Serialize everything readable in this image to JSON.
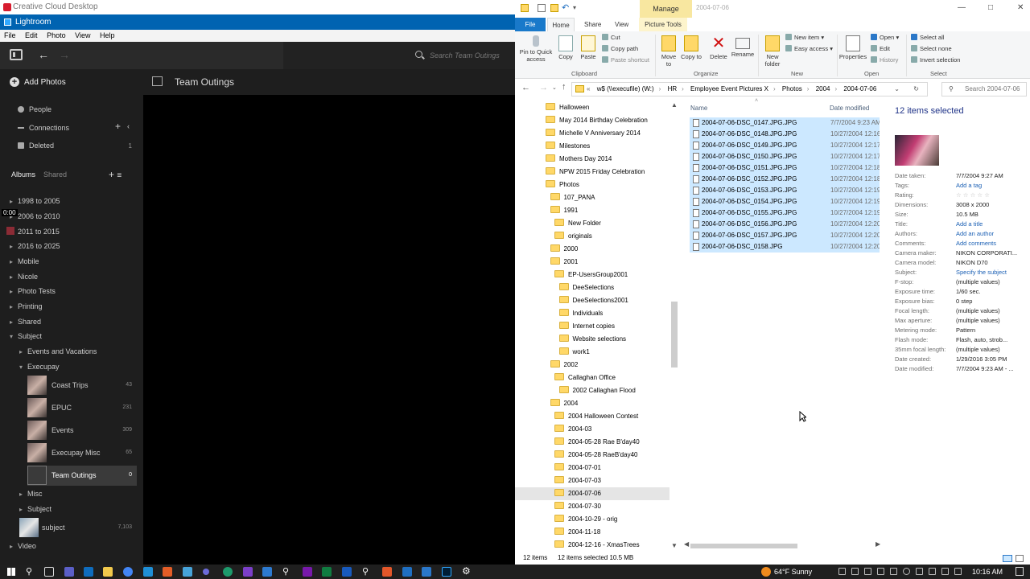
{
  "cc_title": "Creative Cloud Desktop",
  "lr": {
    "title": "Lightroom",
    "menu": [
      "File",
      "Edit",
      "Photo",
      "View",
      "Help"
    ],
    "search_placeholder": "Search Team Outings",
    "add_photos": "Add Photos",
    "nav": [
      {
        "label": "People",
        "count": ""
      },
      {
        "label": "Connections",
        "count": ""
      },
      {
        "label": "Deleted",
        "count": "1"
      }
    ],
    "albums_tab": "Albums",
    "shared_tab": "Shared",
    "tree": [
      "1998 to 2005",
      "2006 to 2010",
      "2011 to 2015",
      "2016 to 2025",
      "Mobile",
      "Nicole",
      "Photo Tests",
      "Printing",
      "Shared",
      "Subject"
    ],
    "subject_children": [
      "Events and Vacations",
      "Execupay"
    ],
    "albums": [
      {
        "label": "Coast Trips",
        "count": "43"
      },
      {
        "label": "EPUC",
        "count": "231"
      },
      {
        "label": "Events",
        "count": "309"
      },
      {
        "label": "Execupay Misc",
        "count": "65"
      },
      {
        "label": "Team Outings",
        "count": "0"
      }
    ],
    "tail": [
      "Misc",
      "Subject"
    ],
    "subject_album": {
      "label": "subject",
      "count": "7,103"
    },
    "video": "Video",
    "time_marker": "0:00",
    "main_title": "Team Outings"
  },
  "ex": {
    "manage_tab": "Manage",
    "path_title": "2004-07-06",
    "tabs": {
      "file": "File",
      "home": "Home",
      "share": "Share",
      "view": "View",
      "picture_tools": "Picture Tools"
    },
    "ribbon": {
      "pin": "Pin to Quick access",
      "copy": "Copy",
      "paste": "Paste",
      "cut": "Cut",
      "copy_path": "Copy path",
      "paste_shortcut": "Paste shortcut",
      "move_to": "Move to",
      "copy_to": "Copy to",
      "delete": "Delete",
      "rename": "Rename",
      "new_folder": "New folder",
      "new_item": "New item",
      "easy_access": "Easy access",
      "properties": "Properties",
      "open": "Open",
      "edit": "Edit",
      "history": "History",
      "select_all": "Select all",
      "select_none": "Select none",
      "invert_selection": "Invert selection",
      "groups": [
        "Clipboard",
        "Organize",
        "New",
        "Open",
        "Select"
      ]
    },
    "breadcrumb": [
      "w$ (\\\\execufile) (W:)",
      "HR",
      "Employee Event Pictures X",
      "Photos",
      "2004",
      "2004-07-06"
    ],
    "search_placeholder": "Search 2004-07-06",
    "folders": [
      {
        "label": "Halloween",
        "indent": 0
      },
      {
        "label": "May 2014 Birthday Celebration",
        "indent": 0
      },
      {
        "label": "Michelle V Anniversary 2014",
        "indent": 0
      },
      {
        "label": "Milestones",
        "indent": 0
      },
      {
        "label": "Mothers Day 2014",
        "indent": 0
      },
      {
        "label": "NPW 2015 Friday Celebration",
        "indent": 0
      },
      {
        "label": "Photos",
        "indent": 0
      },
      {
        "label": "107_PANA",
        "indent": 1
      },
      {
        "label": "1991",
        "indent": 1
      },
      {
        "label": "New Folder",
        "indent": 2
      },
      {
        "label": "originals",
        "indent": 2
      },
      {
        "label": "2000",
        "indent": 1
      },
      {
        "label": "2001",
        "indent": 1
      },
      {
        "label": "EP-UsersGroup2001",
        "indent": 2
      },
      {
        "label": "DeeSelections",
        "indent": 3
      },
      {
        "label": "DeeSelections2001",
        "indent": 3
      },
      {
        "label": "Individuals",
        "indent": 3
      },
      {
        "label": "Internet copies",
        "indent": 3
      },
      {
        "label": "Website selections",
        "indent": 3
      },
      {
        "label": "work1",
        "indent": 3
      },
      {
        "label": "2002",
        "indent": 1
      },
      {
        "label": "Callaghan Office",
        "indent": 2
      },
      {
        "label": "2002 Callaghan Flood",
        "indent": 3
      },
      {
        "label": "2004",
        "indent": 1
      },
      {
        "label": "2004 Halloween Contest",
        "indent": 2
      },
      {
        "label": "2004-03",
        "indent": 2
      },
      {
        "label": "2004-05-28 Rae B'day40",
        "indent": 2
      },
      {
        "label": "2004-05-28 RaeB'day40",
        "indent": 2
      },
      {
        "label": "2004-07-01",
        "indent": 2
      },
      {
        "label": "2004-07-03",
        "indent": 2
      },
      {
        "label": "2004-07-06",
        "indent": 2,
        "selected": true
      },
      {
        "label": "2004-07-30",
        "indent": 2
      },
      {
        "label": "2004-10-29 - orig",
        "indent": 2
      },
      {
        "label": "2004-11-18",
        "indent": 2
      },
      {
        "label": "2004-12-16 - XmasTrees",
        "indent": 2
      }
    ],
    "col_name": "Name",
    "col_date": "Date modified",
    "files": [
      {
        "name": "2004-07-06-DSC_0147.JPG.JPG",
        "date": "7/7/2004 9:23 AM"
      },
      {
        "name": "2004-07-06-DSC_0148.JPG.JPG",
        "date": "10/27/2004 12:16 P"
      },
      {
        "name": "2004-07-06-DSC_0149.JPG.JPG",
        "date": "10/27/2004 12:17 P"
      },
      {
        "name": "2004-07-06-DSC_0150.JPG.JPG",
        "date": "10/27/2004 12:17 P"
      },
      {
        "name": "2004-07-06-DSC_0151.JPG.JPG",
        "date": "10/27/2004 12:18 P"
      },
      {
        "name": "2004-07-06-DSC_0152.JPG.JPG",
        "date": "10/27/2004 12:18 P"
      },
      {
        "name": "2004-07-06-DSC_0153.JPG.JPG",
        "date": "10/27/2004 12:19 P"
      },
      {
        "name": "2004-07-06-DSC_0154.JPG.JPG",
        "date": "10/27/2004 12:19 P"
      },
      {
        "name": "2004-07-06-DSC_0155.JPG.JPG",
        "date": "10/27/2004 12:19 P"
      },
      {
        "name": "2004-07-06-DSC_0156.JPG.JPG",
        "date": "10/27/2004 12:20 P"
      },
      {
        "name": "2004-07-06-DSC_0157.JPG.JPG",
        "date": "10/27/2004 12:20 P"
      },
      {
        "name": "2004-07-06-DSC_0158.JPG",
        "date": "10/27/2004 12:20 P"
      }
    ],
    "details_title": "12 items selected",
    "details": [
      {
        "k": "Date taken:",
        "v": "7/7/2004 9:27 AM"
      },
      {
        "k": "Tags:",
        "v": "Add a tag",
        "link": true
      },
      {
        "k": "Rating:",
        "v": "☆ ☆ ☆ ☆ ☆"
      },
      {
        "k": "Dimensions:",
        "v": "3008 x 2000"
      },
      {
        "k": "Size:",
        "v": "10.5 MB"
      },
      {
        "k": "Title:",
        "v": "Add a title",
        "link": true
      },
      {
        "k": "Authors:",
        "v": "Add an author",
        "link": true
      },
      {
        "k": "Comments:",
        "v": "Add comments",
        "link": true
      },
      {
        "k": "Camera maker:",
        "v": "NIKON CORPORATI..."
      },
      {
        "k": "Camera model:",
        "v": "NIKON D70"
      },
      {
        "k": "Subject:",
        "v": "Specify the subject",
        "link": true
      },
      {
        "k": "F-stop:",
        "v": "(multiple values)"
      },
      {
        "k": "Exposure time:",
        "v": "1/60 sec."
      },
      {
        "k": "Exposure bias:",
        "v": "0 step"
      },
      {
        "k": "Focal length:",
        "v": "(multiple values)"
      },
      {
        "k": "Max aperture:",
        "v": "(multiple values)"
      },
      {
        "k": "Metering mode:",
        "v": "Pattern"
      },
      {
        "k": "Flash mode:",
        "v": "Flash, auto, strob..."
      },
      {
        "k": "35mm focal length:",
        "v": "(multiple values)"
      },
      {
        "k": "Date created:",
        "v": "1/29/2016 3:05 PM"
      },
      {
        "k": "Date modified:",
        "v": "7/7/2004 9:23 AM - ..."
      }
    ],
    "status_items": "12 items",
    "status_selected": "12 items selected  10.5 MB"
  },
  "taskbar": {
    "weather": "64°F  Sunny",
    "time": "10:16 AM"
  },
  "colors": {
    "lr_bg": "#1e1e1e",
    "lr_titlebar": "#0063b1",
    "ex_select": "#cce8ff",
    "folder": "#ffd868"
  }
}
